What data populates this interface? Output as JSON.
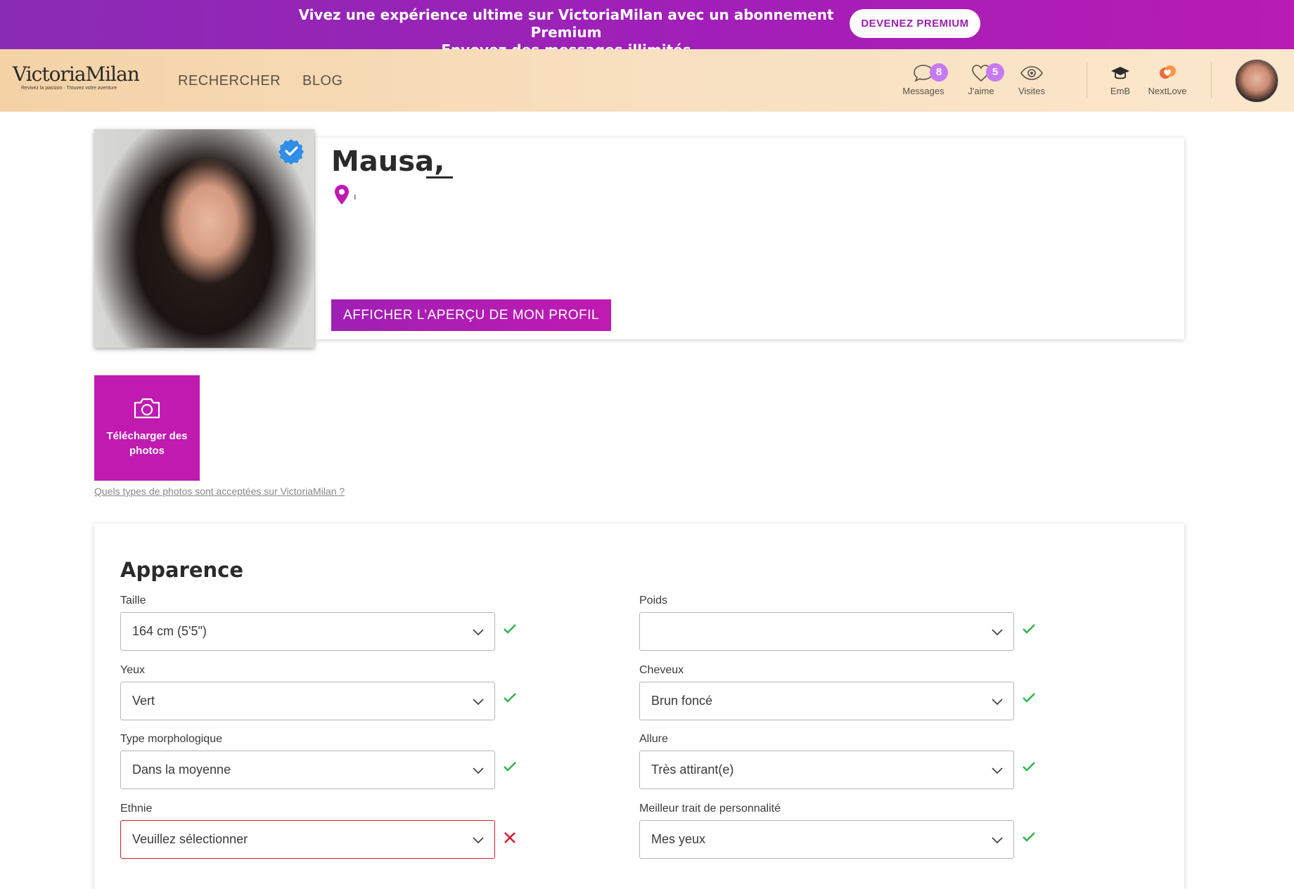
{
  "promo": {
    "line1": "Vivez une expérience ultime sur VictoriaMilan avec un abonnement Premium",
    "line2": "Envoyez des messages illimités",
    "cta": "DEVENEZ PREMIUM"
  },
  "nav": {
    "logo": "VictoriaMilan",
    "logo_tagline": "Revivez la passion · Trouvez votre aventure",
    "links": [
      "RECHERCHER",
      "BLOG"
    ],
    "icons": [
      {
        "label": "Messages",
        "badge": "8",
        "icon": "chat-icon"
      },
      {
        "label": "J'aime",
        "badge": "5",
        "icon": "heart-icon"
      },
      {
        "label": "Visites",
        "badge": "",
        "icon": "eye-icon"
      },
      {
        "label": "EmB",
        "badge": "",
        "icon": "graduation-cap-icon"
      },
      {
        "label": "NextLove",
        "badge": "",
        "icon": "nextlove-icon"
      }
    ]
  },
  "profile": {
    "name": "Mausa,",
    "location": "ı",
    "preview_button": "AFFICHER L’APERÇU DE MON PROFIL"
  },
  "upload": {
    "label": "Télécharger des photos",
    "help_link": "Quels types de photos sont acceptées sur VictoriaMilan ?"
  },
  "appearance": {
    "title": "Apparence",
    "fields": [
      {
        "label": "Taille",
        "value": "164 cm (5'5\")",
        "status": "ok"
      },
      {
        "label": "Poids",
        "value": "",
        "status": "ok"
      },
      {
        "label": "Yeux",
        "value": "Vert",
        "status": "ok"
      },
      {
        "label": "Cheveux",
        "value": "Brun foncé",
        "status": "ok"
      },
      {
        "label": "Type morphologique",
        "value": "Dans la moyenne",
        "status": "ok"
      },
      {
        "label": "Allure",
        "value": "Très attirant(e)",
        "status": "ok"
      },
      {
        "label": "Ethnie",
        "value": "Veuillez sélectionner",
        "status": "error"
      },
      {
        "label": "Meilleur trait de personnalité",
        "value": "Mes yeux",
        "status": "ok"
      }
    ]
  },
  "colors": {
    "brand_purple": "#c01ab1",
    "promo_start": "#8a2bb5",
    "nav_bg": "#f8e0c0",
    "badge": "#c67af0",
    "ok_green": "#2fb44b",
    "error_red": "#d41f2a",
    "verified_blue": "#2e8ee8"
  }
}
